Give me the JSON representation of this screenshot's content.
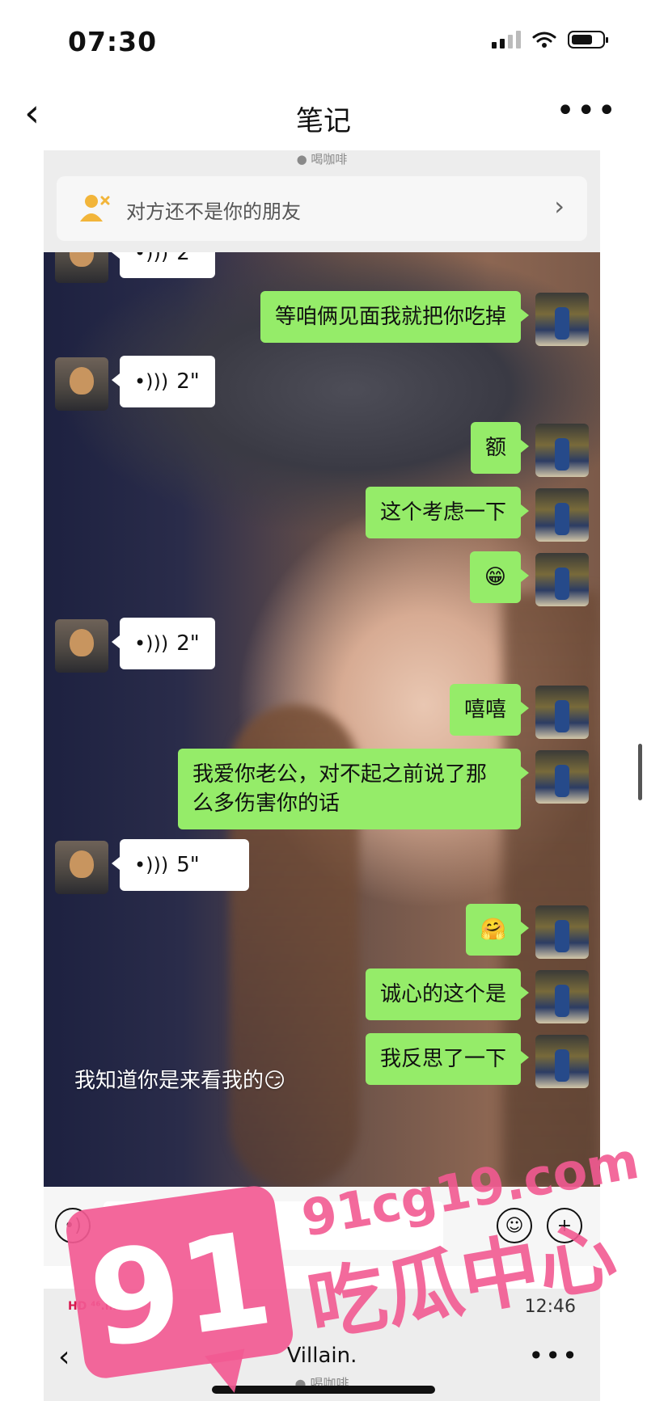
{
  "status_bar": {
    "time": "07:30"
  },
  "nav": {
    "title": "笔记"
  },
  "screenshot": {
    "top_strip": "● 喝咖啡",
    "friend_notice": "对方还不是你的朋友",
    "messages": [
      {
        "from": "them",
        "type": "voice",
        "duration": "2\""
      },
      {
        "from": "me",
        "text": "等咱俩见面我就把你吃掉"
      },
      {
        "from": "them",
        "type": "voice",
        "duration": "2\""
      },
      {
        "from": "me",
        "text": "额"
      },
      {
        "from": "me",
        "text": "这个考虑一下"
      },
      {
        "from": "me",
        "text": "😁"
      },
      {
        "from": "them",
        "type": "voice",
        "duration": "2\""
      },
      {
        "from": "me",
        "text": "嘻嘻"
      },
      {
        "from": "me",
        "text": "我爱你老公，对不起之前说了那么多伤害你的话"
      },
      {
        "from": "them",
        "type": "voice",
        "duration": "5\""
      },
      {
        "from": "me",
        "text": "🤗"
      },
      {
        "from": "me",
        "text": "诚心的这个是"
      },
      {
        "from": "me",
        "text": "我反思了一下"
      }
    ],
    "overlay_caption": "我知道你是来看我的😏",
    "second_screen": {
      "carrier": "HD ⁴⁶.ıll",
      "time": "12:46",
      "contact_name": "Villain.",
      "subtitle": "● 喝咖啡"
    }
  },
  "watermark": {
    "big": "91",
    "domain": "91cg19.com",
    "label": "吃瓜中心"
  },
  "colors": {
    "my_bubble": "#95ec69",
    "their_bubble": "#ffffff",
    "watermark": "#f25a92"
  }
}
